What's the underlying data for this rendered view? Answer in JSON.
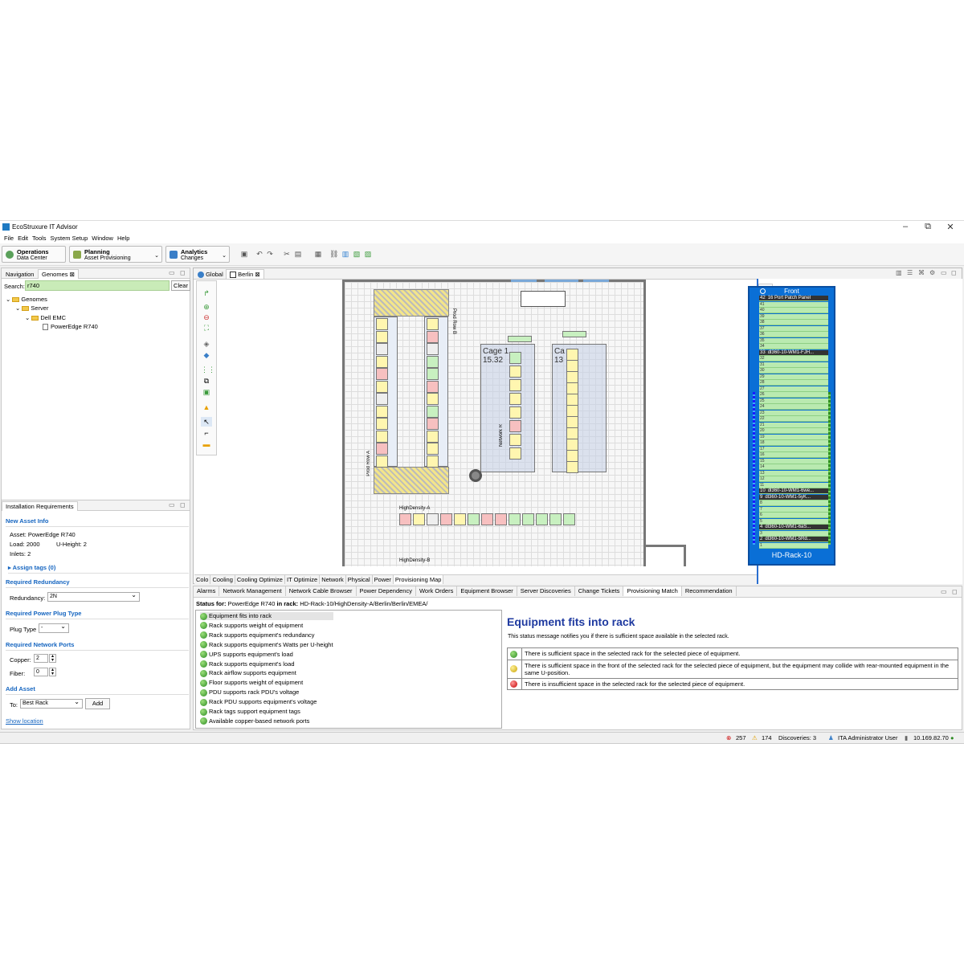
{
  "window": {
    "title": "EcoStruxure IT Advisor",
    "minimize": "–",
    "restore": "⧉",
    "close": "✕"
  },
  "menu": [
    "File",
    "Edit",
    "Tools",
    "System Setup",
    "Window",
    "Help"
  ],
  "perspectives": [
    {
      "title": "Operations",
      "subtitle": "Data Center",
      "color": "#5aa05a"
    },
    {
      "title": "Planning",
      "subtitle": "Asset Provisioning",
      "color": "#8aa84a"
    },
    {
      "title": "Analytics",
      "subtitle": "Changes",
      "color": "#3a7fc8"
    }
  ],
  "nav": {
    "tabs": [
      "Navigation",
      "Genomes"
    ],
    "search_label": "Search:",
    "search_value": "r740",
    "clear_label": "Clear",
    "tree": [
      "Genomes",
      "Server",
      "Dell EMC",
      "PowerEdge R740"
    ]
  },
  "install": {
    "tab": "Installation Requirements",
    "new_asset_title": "New Asset Info",
    "asset": "Asset: PowerEdge R740",
    "load": "Load:  2000",
    "uheight": "U-Height:  2",
    "inlets": "Inlets:  2",
    "assign_tags": "Assign tags (0)",
    "redundancy_title": "Required Redundancy",
    "redundancy_label": "Redundancy:",
    "redundancy_value": "2N",
    "plug_title": "Required Power Plug Type",
    "plug_label": "Plug Type",
    "plug_value": "-",
    "ports_title": "Required Network Ports",
    "copper_label": "Copper:",
    "copper_value": "2",
    "fiber_label": "Fiber:",
    "fiber_value": "0",
    "add_title": "Add Asset",
    "to_label": "To:",
    "to_value": "Best Rack",
    "add_btn": "Add",
    "show_location": "Show location"
  },
  "editor": {
    "tabs": [
      "Global",
      "Berlin"
    ]
  },
  "map": {
    "labels": {
      "cage1": "Cage 1",
      "cage1_num": "15.32",
      "cage2": "Ca",
      "cage2_num": "13",
      "row_b": "Prod Row B",
      "row_a": "Prod Row A",
      "network": "Network R",
      "hd_a": "HighDensity-A",
      "hd_b": "HighDensity-B"
    },
    "view_tabs": [
      "Colo",
      "Cooling",
      "Cooling Optimize",
      "IT Optimize",
      "Network",
      "Physical",
      "Power",
      "Provisioning Map"
    ]
  },
  "rack": {
    "header": "Front",
    "name": "HD-Rack-10",
    "units": [
      {
        "u": "42",
        "label": "16 Port Patch Panel",
        "dark": true
      },
      {
        "u": "41",
        "label": ""
      },
      {
        "u": "40",
        "label": ""
      },
      {
        "u": "39",
        "label": ""
      },
      {
        "u": "38",
        "label": ""
      },
      {
        "u": "37",
        "label": ""
      },
      {
        "u": "36",
        "label": ""
      },
      {
        "u": "35",
        "label": ""
      },
      {
        "u": "34",
        "label": ""
      },
      {
        "u": "33",
        "label": "dl360-10-WM1-FJH...",
        "dark": true
      },
      {
        "u": "32",
        "label": ""
      },
      {
        "u": "31",
        "label": ""
      },
      {
        "u": "30",
        "label": ""
      },
      {
        "u": "29",
        "label": ""
      },
      {
        "u": "28",
        "label": ""
      },
      {
        "u": "27",
        "label": ""
      },
      {
        "u": "26",
        "label": ""
      },
      {
        "u": "25",
        "label": ""
      },
      {
        "u": "24",
        "label": ""
      },
      {
        "u": "23",
        "label": ""
      },
      {
        "u": "22",
        "label": ""
      },
      {
        "u": "21",
        "label": ""
      },
      {
        "u": "20",
        "label": ""
      },
      {
        "u": "19",
        "label": ""
      },
      {
        "u": "18",
        "label": ""
      },
      {
        "u": "17",
        "label": ""
      },
      {
        "u": "16",
        "label": ""
      },
      {
        "u": "15",
        "label": ""
      },
      {
        "u": "14",
        "label": ""
      },
      {
        "u": "13",
        "label": ""
      },
      {
        "u": "12",
        "label": ""
      },
      {
        "u": "11",
        "label": ""
      },
      {
        "u": "10",
        "label": "dl360-10-WM1-6we...",
        "dark": true
      },
      {
        "u": "9",
        "label": "dl360-10-WM1-5yK...",
        "dark": true
      },
      {
        "u": "8",
        "label": ""
      },
      {
        "u": "7",
        "label": ""
      },
      {
        "u": "6",
        "label": ""
      },
      {
        "u": "5",
        "label": ""
      },
      {
        "u": "4",
        "label": "dl360-10-WM1-6aS...",
        "dark": true
      },
      {
        "u": "3",
        "label": ""
      },
      {
        "u": "2",
        "label": "dl360-10-WM1-5Rd...",
        "dark": true
      },
      {
        "u": "1",
        "label": ""
      }
    ]
  },
  "bottom": {
    "tabs": [
      "Alarms",
      "Network Management",
      "Network Cable Browser",
      "Power Dependency",
      "Work Orders",
      "Equipment Browser",
      "Server Discoveries",
      "Change Tickets",
      "Provisioning Match",
      "Recommendation"
    ],
    "active_tab": 8,
    "status_prefix": "Status for:",
    "status_text": "PowerEdge R740",
    "status_in_rack": "in rack:",
    "status_rack": "HD-Rack-10/HighDensity-A/Berlin/Berlin/EMEA/",
    "checks": [
      "Equipment fits into rack",
      "Rack supports weight of equipment",
      "Rack supports equipment's redundancy",
      "Rack supports equipment's Watts per U-height",
      "UPS supports equipment's load",
      "Rack supports equipment's load",
      "Rack airflow supports equipment",
      "Floor supports weight of equipment",
      "PDU supports rack PDU's voltage",
      "Rack PDU supports equipment's voltage",
      "Rack tags support equipment tags",
      "Available copper-based network ports"
    ],
    "detail_title": "Equipment fits into rack",
    "detail_desc": "This status message notifies you if there is sufficient space available in the selected rack.",
    "legend": [
      {
        "color": "green",
        "text": "There is sufficient space in the selected rack for the selected piece of equipment."
      },
      {
        "color": "yellow",
        "text": "There is sufficient space in the front of the selected rack for the selected piece of equipment, but the equipment may collide with rear-mounted equipment in the same U-position."
      },
      {
        "color": "red",
        "text": "There is insufficient space in the selected rack for the selected piece of equipment."
      }
    ]
  },
  "status": {
    "errors": "257",
    "warnings": "174",
    "discoveries": "Discoveries: 3",
    "user": "ITA Administrator User",
    "ip": "10.169.82.70"
  }
}
